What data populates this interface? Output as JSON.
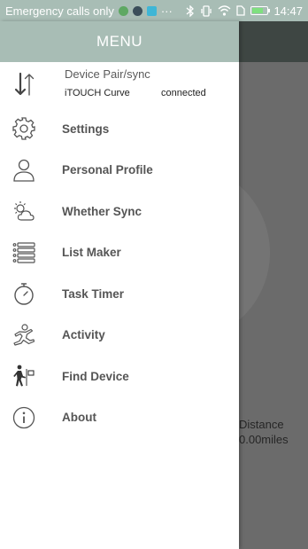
{
  "status_bar": {
    "carrier_text": "Emergency calls only",
    "overflow_glyph": "···",
    "time": "14:47",
    "icons": [
      "app-notification-icon",
      "app-notification-icon",
      "app-notification-icon",
      "bluetooth-icon",
      "vibrate-icon",
      "wifi-icon",
      "sim-icon",
      "battery-icon"
    ]
  },
  "background_screen": {
    "stat_label": "Distance",
    "stat_value": "0.00miles"
  },
  "drawer": {
    "title": "MENU",
    "pair": {
      "icon": "sync-arrows-icon",
      "title": "Device Pair/sync",
      "device_name": "iTOUCH Curve",
      "status": "connected"
    },
    "items": [
      {
        "icon": "gear-icon",
        "label": "Settings"
      },
      {
        "icon": "person-icon",
        "label": "Personal Profile"
      },
      {
        "icon": "weather-icon",
        "label": "Whether Sync"
      },
      {
        "icon": "list-icon",
        "label": "List Maker"
      },
      {
        "icon": "stopwatch-icon",
        "label": "Task Timer"
      },
      {
        "icon": "running-icon",
        "label": "Activity"
      },
      {
        "icon": "find-device-icon",
        "label": "Find Device"
      },
      {
        "icon": "info-icon",
        "label": "About"
      }
    ]
  },
  "colors": {
    "header": "#a8bdb5",
    "overlay": "#6b6b6b",
    "icon_stroke": "#555555",
    "label": "#555555"
  }
}
